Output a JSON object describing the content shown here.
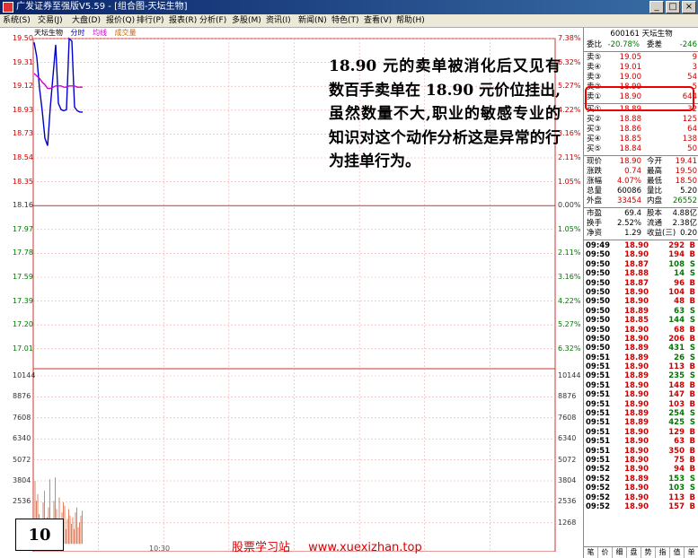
{
  "window": {
    "title": "广发证券至强版V5.59 - [组合图-天坛生物]"
  },
  "menu": [
    "系统(S)",
    "交易(J)",
    "大盘(D)",
    "报价(Q)",
    "排行(P)",
    "报表(R)",
    "分析(F)",
    "多股(M)",
    "资讯(I)",
    "新闻(N)",
    "特色(T)",
    "查看(V)",
    "帮助(H)"
  ],
  "chart": {
    "legend": {
      "name": "天坛生物",
      "mode": "分时",
      "avg": "均线",
      "vol": "成交量"
    },
    "price_labels": [
      "19.50",
      "19.31",
      "19.12",
      "18.93",
      "18.73",
      "18.54",
      "18.35",
      "18.16",
      "17.97",
      "17.78",
      "17.59",
      "17.39",
      "17.20",
      "17.01"
    ],
    "pct_labels": [
      "7.38%",
      "6.32%",
      "5.27%",
      "4.22%",
      "3.16%",
      "2.11%",
      "1.05%",
      "0.00%",
      "1.05%",
      "2.11%",
      "3.16%",
      "4.22%",
      "5.27%",
      "6.32%"
    ],
    "vol_labels": [
      "10144",
      "8876",
      "7608",
      "6340",
      "5072",
      "3804",
      "2536"
    ],
    "vol_labels_right": [
      "10144",
      "8876",
      "7608",
      "6340",
      "5072",
      "3804",
      "2536",
      "1268"
    ],
    "time_label": "10:30"
  },
  "chart_data": {
    "type": "line",
    "title": "天坛生物",
    "series": [
      {
        "name": "分时",
        "values": [
          19.47,
          19.35,
          19.1,
          18.92,
          18.7,
          18.64,
          18.95,
          19.2,
          19.45,
          18.98,
          18.93,
          18.92,
          18.93,
          19.5,
          19.48,
          18.95,
          18.92,
          18.91,
          18.91
        ]
      },
      {
        "name": "均线",
        "values": [
          19.22,
          19.2,
          19.18,
          19.15,
          19.13,
          19.1,
          19.1,
          19.11,
          19.12,
          19.12,
          19.12,
          19.11,
          19.11,
          19.12,
          19.12,
          19.12,
          19.11,
          19.11,
          19.11
        ]
      }
    ],
    "ylim": [
      17.01,
      19.5
    ],
    "volume": [
      3800,
      2600,
      3000,
      1800,
      1500,
      1100,
      2500,
      3200,
      900,
      1600,
      2200,
      3900,
      700,
      1300,
      2600,
      4000,
      2100,
      1200,
      2800,
      1400,
      1900,
      2500,
      2300,
      900,
      1500,
      2100,
      1700,
      1200,
      1600,
      900,
      1900,
      2200,
      1000,
      1300,
      1700,
      2000
    ],
    "vol_ylim": [
      0,
      10144
    ]
  },
  "annotation": "18.90 元的卖单被消化后又见有数百手卖单在 18.90 元价位挂出,虽然数量不大,职业的敏感专业的知识对这个动作分析这是异常的行为挂单行为。",
  "slide_number": "10",
  "watermark": {
    "left": "股票学习站",
    "right": "www.xuexizhan.top"
  },
  "quote": {
    "code_name": "600161 天坛生物",
    "webi": {
      "label": "委比",
      "value": "-20.78%",
      "label2": "委差",
      "value2": "-246"
    },
    "sells": [
      {
        "label": "卖⑤",
        "price": "19.05",
        "vol": "9"
      },
      {
        "label": "卖④",
        "price": "19.01",
        "vol": "3"
      },
      {
        "label": "卖③",
        "price": "19.00",
        "vol": "54"
      },
      {
        "label": "卖②",
        "price": "18.99",
        "vol": "5"
      },
      {
        "label": "卖①",
        "price": "18.90",
        "vol": "644"
      }
    ],
    "buys": [
      {
        "label": "买①",
        "price": "18.89",
        "vol": "32"
      },
      {
        "label": "买②",
        "price": "18.88",
        "vol": "125"
      },
      {
        "label": "买③",
        "price": "18.86",
        "vol": "64"
      },
      {
        "label": "买④",
        "price": "18.85",
        "vol": "138"
      },
      {
        "label": "买⑤",
        "price": "18.84",
        "vol": "50"
      }
    ],
    "stats": [
      {
        "l1": "现价",
        "v1": "18.90",
        "l2": "今开",
        "v2": "19.41",
        "c1": "red",
        "c2": "red"
      },
      {
        "l1": "涨跌",
        "v1": "0.74",
        "l2": "最高",
        "v2": "19.50",
        "c1": "red",
        "c2": "red"
      },
      {
        "l1": "涨幅",
        "v1": "4.07%",
        "l2": "最低",
        "v2": "18.50",
        "c1": "red",
        "c2": "red"
      },
      {
        "l1": "总量",
        "v1": "60086",
        "l2": "量比",
        "v2": "5.20",
        "c1": "blk",
        "c2": "blk"
      },
      {
        "l1": "外盘",
        "v1": "33454",
        "l2": "内盘",
        "v2": "26552",
        "c1": "red",
        "c2": "green"
      }
    ],
    "stats2": [
      {
        "l1": "市盈",
        "v1": "69.4",
        "l2": "股本",
        "v2": "4.88亿"
      },
      {
        "l1": "换手",
        "v1": "2.52%",
        "l2": "流通",
        "v2": "2.38亿"
      },
      {
        "l1": "净资",
        "v1": "1.29",
        "l2": "收益(三)",
        "v2": "0.20"
      }
    ]
  },
  "ticks": [
    {
      "t": "09:49",
      "p": "18.90",
      "v": "292",
      "s": "B"
    },
    {
      "t": "09:50",
      "p": "18.90",
      "v": "194",
      "s": "B"
    },
    {
      "t": "09:50",
      "p": "18.87",
      "v": "108",
      "s": "S"
    },
    {
      "t": "09:50",
      "p": "18.88",
      "v": "14",
      "s": "S"
    },
    {
      "t": "09:50",
      "p": "18.87",
      "v": "96",
      "s": "B"
    },
    {
      "t": "09:50",
      "p": "18.90",
      "v": "104",
      "s": "B"
    },
    {
      "t": "09:50",
      "p": "18.90",
      "v": "48",
      "s": "B"
    },
    {
      "t": "09:50",
      "p": "18.89",
      "v": "63",
      "s": "S"
    },
    {
      "t": "09:50",
      "p": "18.85",
      "v": "144",
      "s": "S"
    },
    {
      "t": "09:50",
      "p": "18.90",
      "v": "68",
      "s": "B"
    },
    {
      "t": "09:50",
      "p": "18.90",
      "v": "206",
      "s": "B"
    },
    {
      "t": "09:50",
      "p": "18.89",
      "v": "431",
      "s": "S"
    },
    {
      "t": "09:51",
      "p": "18.89",
      "v": "26",
      "s": "S"
    },
    {
      "t": "09:51",
      "p": "18.90",
      "v": "113",
      "s": "B"
    },
    {
      "t": "09:51",
      "p": "18.89",
      "v": "235",
      "s": "S"
    },
    {
      "t": "09:51",
      "p": "18.90",
      "v": "148",
      "s": "B"
    },
    {
      "t": "09:51",
      "p": "18.90",
      "v": "147",
      "s": "B"
    },
    {
      "t": "09:51",
      "p": "18.90",
      "v": "103",
      "s": "B"
    },
    {
      "t": "09:51",
      "p": "18.89",
      "v": "254",
      "s": "S"
    },
    {
      "t": "09:51",
      "p": "18.89",
      "v": "425",
      "s": "S"
    },
    {
      "t": "09:51",
      "p": "18.90",
      "v": "129",
      "s": "B"
    },
    {
      "t": "09:51",
      "p": "18.90",
      "v": "63",
      "s": "B"
    },
    {
      "t": "09:51",
      "p": "18.90",
      "v": "350",
      "s": "B"
    },
    {
      "t": "09:51",
      "p": "18.90",
      "v": "75",
      "s": "B"
    },
    {
      "t": "09:52",
      "p": "18.90",
      "v": "94",
      "s": "B"
    },
    {
      "t": "09:52",
      "p": "18.89",
      "v": "153",
      "s": "S"
    },
    {
      "t": "09:52",
      "p": "18.90",
      "v": "103",
      "s": "S"
    },
    {
      "t": "09:52",
      "p": "18.90",
      "v": "113",
      "s": "B"
    },
    {
      "t": "09:52",
      "p": "18.90",
      "v": "157",
      "s": "B"
    }
  ],
  "bottom_tabs": [
    "笔",
    "价",
    "细",
    "盘",
    "势",
    "指",
    "值",
    "单"
  ]
}
